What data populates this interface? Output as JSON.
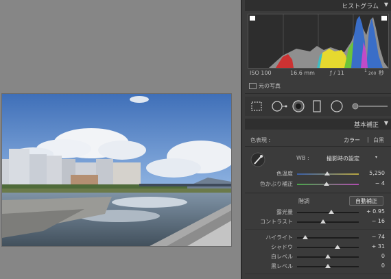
{
  "histogram": {
    "title": "ヒストグラム",
    "iso": "ISO 100",
    "focal": "16.6 mm",
    "aperture": "ƒ / 11",
    "shutter_num": "1",
    "shutter_den": "200",
    "shutter_unit": "秒",
    "original_photo_label": "元の写真"
  },
  "basic": {
    "title": "基本補正",
    "treatment_label": "色表現 :",
    "treatment_color": "カラー",
    "treatment_sep": "|",
    "treatment_bw": "白黒",
    "wb_label": "WB :",
    "wb_value": "撮影時の設定",
    "temp_label": "色温度",
    "temp_value": "5,250",
    "temp_level": 0.49,
    "tint_label": "色かぶり補正",
    "tint_value": "− 4",
    "tint_level": 0.48,
    "tone_label": "階調",
    "auto_button": "自動補正",
    "exposure_label": "露光量",
    "exposure_value": "+ 0.95",
    "exposure_level": 0.56,
    "contrast_label": "コントラスト",
    "contrast_value": "− 16",
    "contrast_level": 0.42,
    "highlights_label": "ハイライト",
    "highlights_value": "− 74",
    "highlights_level": 0.13,
    "shadows_label": "シャドウ",
    "shadows_value": "+ 31",
    "shadows_level": 0.65,
    "whites_label": "白レベル",
    "whites_value": "0",
    "whites_level": 0.5,
    "blacks_label": "黒レベル",
    "blacks_value": "0",
    "blacks_level": 0.5
  },
  "colors": {
    "panel_bg": "#3b3b3b",
    "header_bg": "#2f2f2f",
    "canvas_bg": "#868686"
  }
}
